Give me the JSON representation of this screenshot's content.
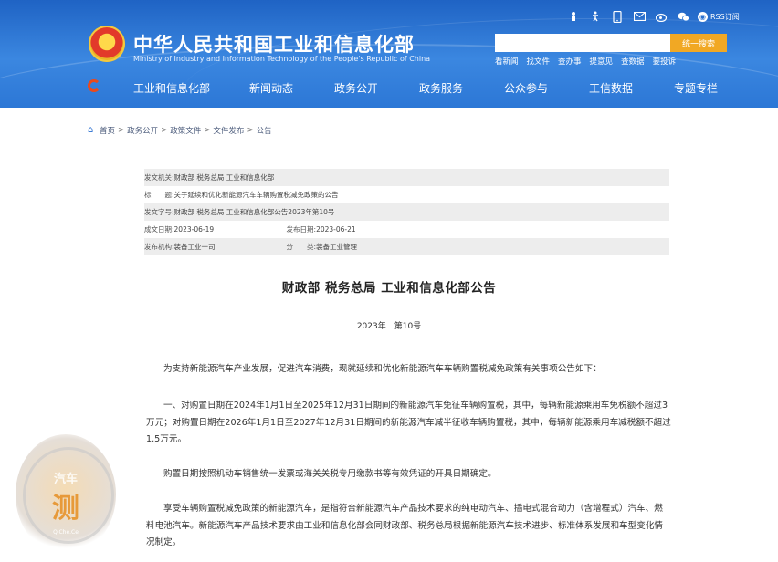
{
  "header": {
    "title": "中华人民共和国工业和信息化部",
    "subtitle": "Ministry of Industry and Information Technology of the People's Republic of China",
    "rss_label": "RSS订阅",
    "search": {
      "placeholder": "",
      "button": "统一搜索"
    },
    "quicklinks": [
      "看新闻",
      "找文件",
      "查办事",
      "提意见",
      "查数据",
      "要投诉"
    ],
    "nav": [
      "工业和信息化部",
      "新闻动态",
      "政务公开",
      "政务服务",
      "公众参与",
      "工信数据",
      "专题专栏"
    ],
    "colors": {
      "header_blue": "#2c77d6",
      "search_button": "#f1a824"
    }
  },
  "breadcrumb": [
    "首页",
    "政务公开",
    "政策文件",
    "文件发布",
    "公告"
  ],
  "info": {
    "issuer_label": "发文机关:",
    "issuer": "财政部 税务总局 工业和信息化部",
    "title_label": "标　　题:",
    "title": "关于延续和优化新能源汽车车辆购置税减免政策的公告",
    "docno_label": "发文字号:",
    "docno": "财政部 税务总局 工业和信息化部公告2023年第10号",
    "created_label": "成文日期:",
    "created": "2023-06-19",
    "published_label": "发布日期:",
    "published": "2023-06-21",
    "org_label": "发布机构:",
    "org": "装备工业一司",
    "category_label": "分　　类:",
    "category": "装备工业管理"
  },
  "article": {
    "title": "财政部 税务总局 工业和信息化部公告",
    "number": "2023年　第10号",
    "paragraphs": [
      "为支持新能源汽车产业发展，促进汽车消费，现就延续和优化新能源汽车车辆购置税减免政策有关事项公告如下：",
      "一、对购置日期在2024年1月1日至2025年12月31日期间的新能源汽车免征车辆购置税，其中，每辆新能源乘用车免税额不超过3万元；对购置日期在2026年1月1日至2027年12月31日期间的新能源汽车减半征收车辆购置税，其中，每辆新能源乘用车减税额不超过1.5万元。",
      "购置日期按照机动车销售统一发票或海关关税专用缴款书等有效凭证的开具日期确定。",
      "享受车辆购置税减免政策的新能源汽车，是指符合新能源汽车产品技术要求的纯电动汽车、插电式混合动力（含增程式）汽车、燃料电池汽车。新能源汽车产品技术要求由工业和信息化部会同财政部、税务总局根据新能源汽车技术进步、标准体系发展和车型变化情况制定。"
    ]
  },
  "watermark": {
    "line1": "汽车",
    "big": "测",
    "sub": "QiChe.Ce"
  }
}
